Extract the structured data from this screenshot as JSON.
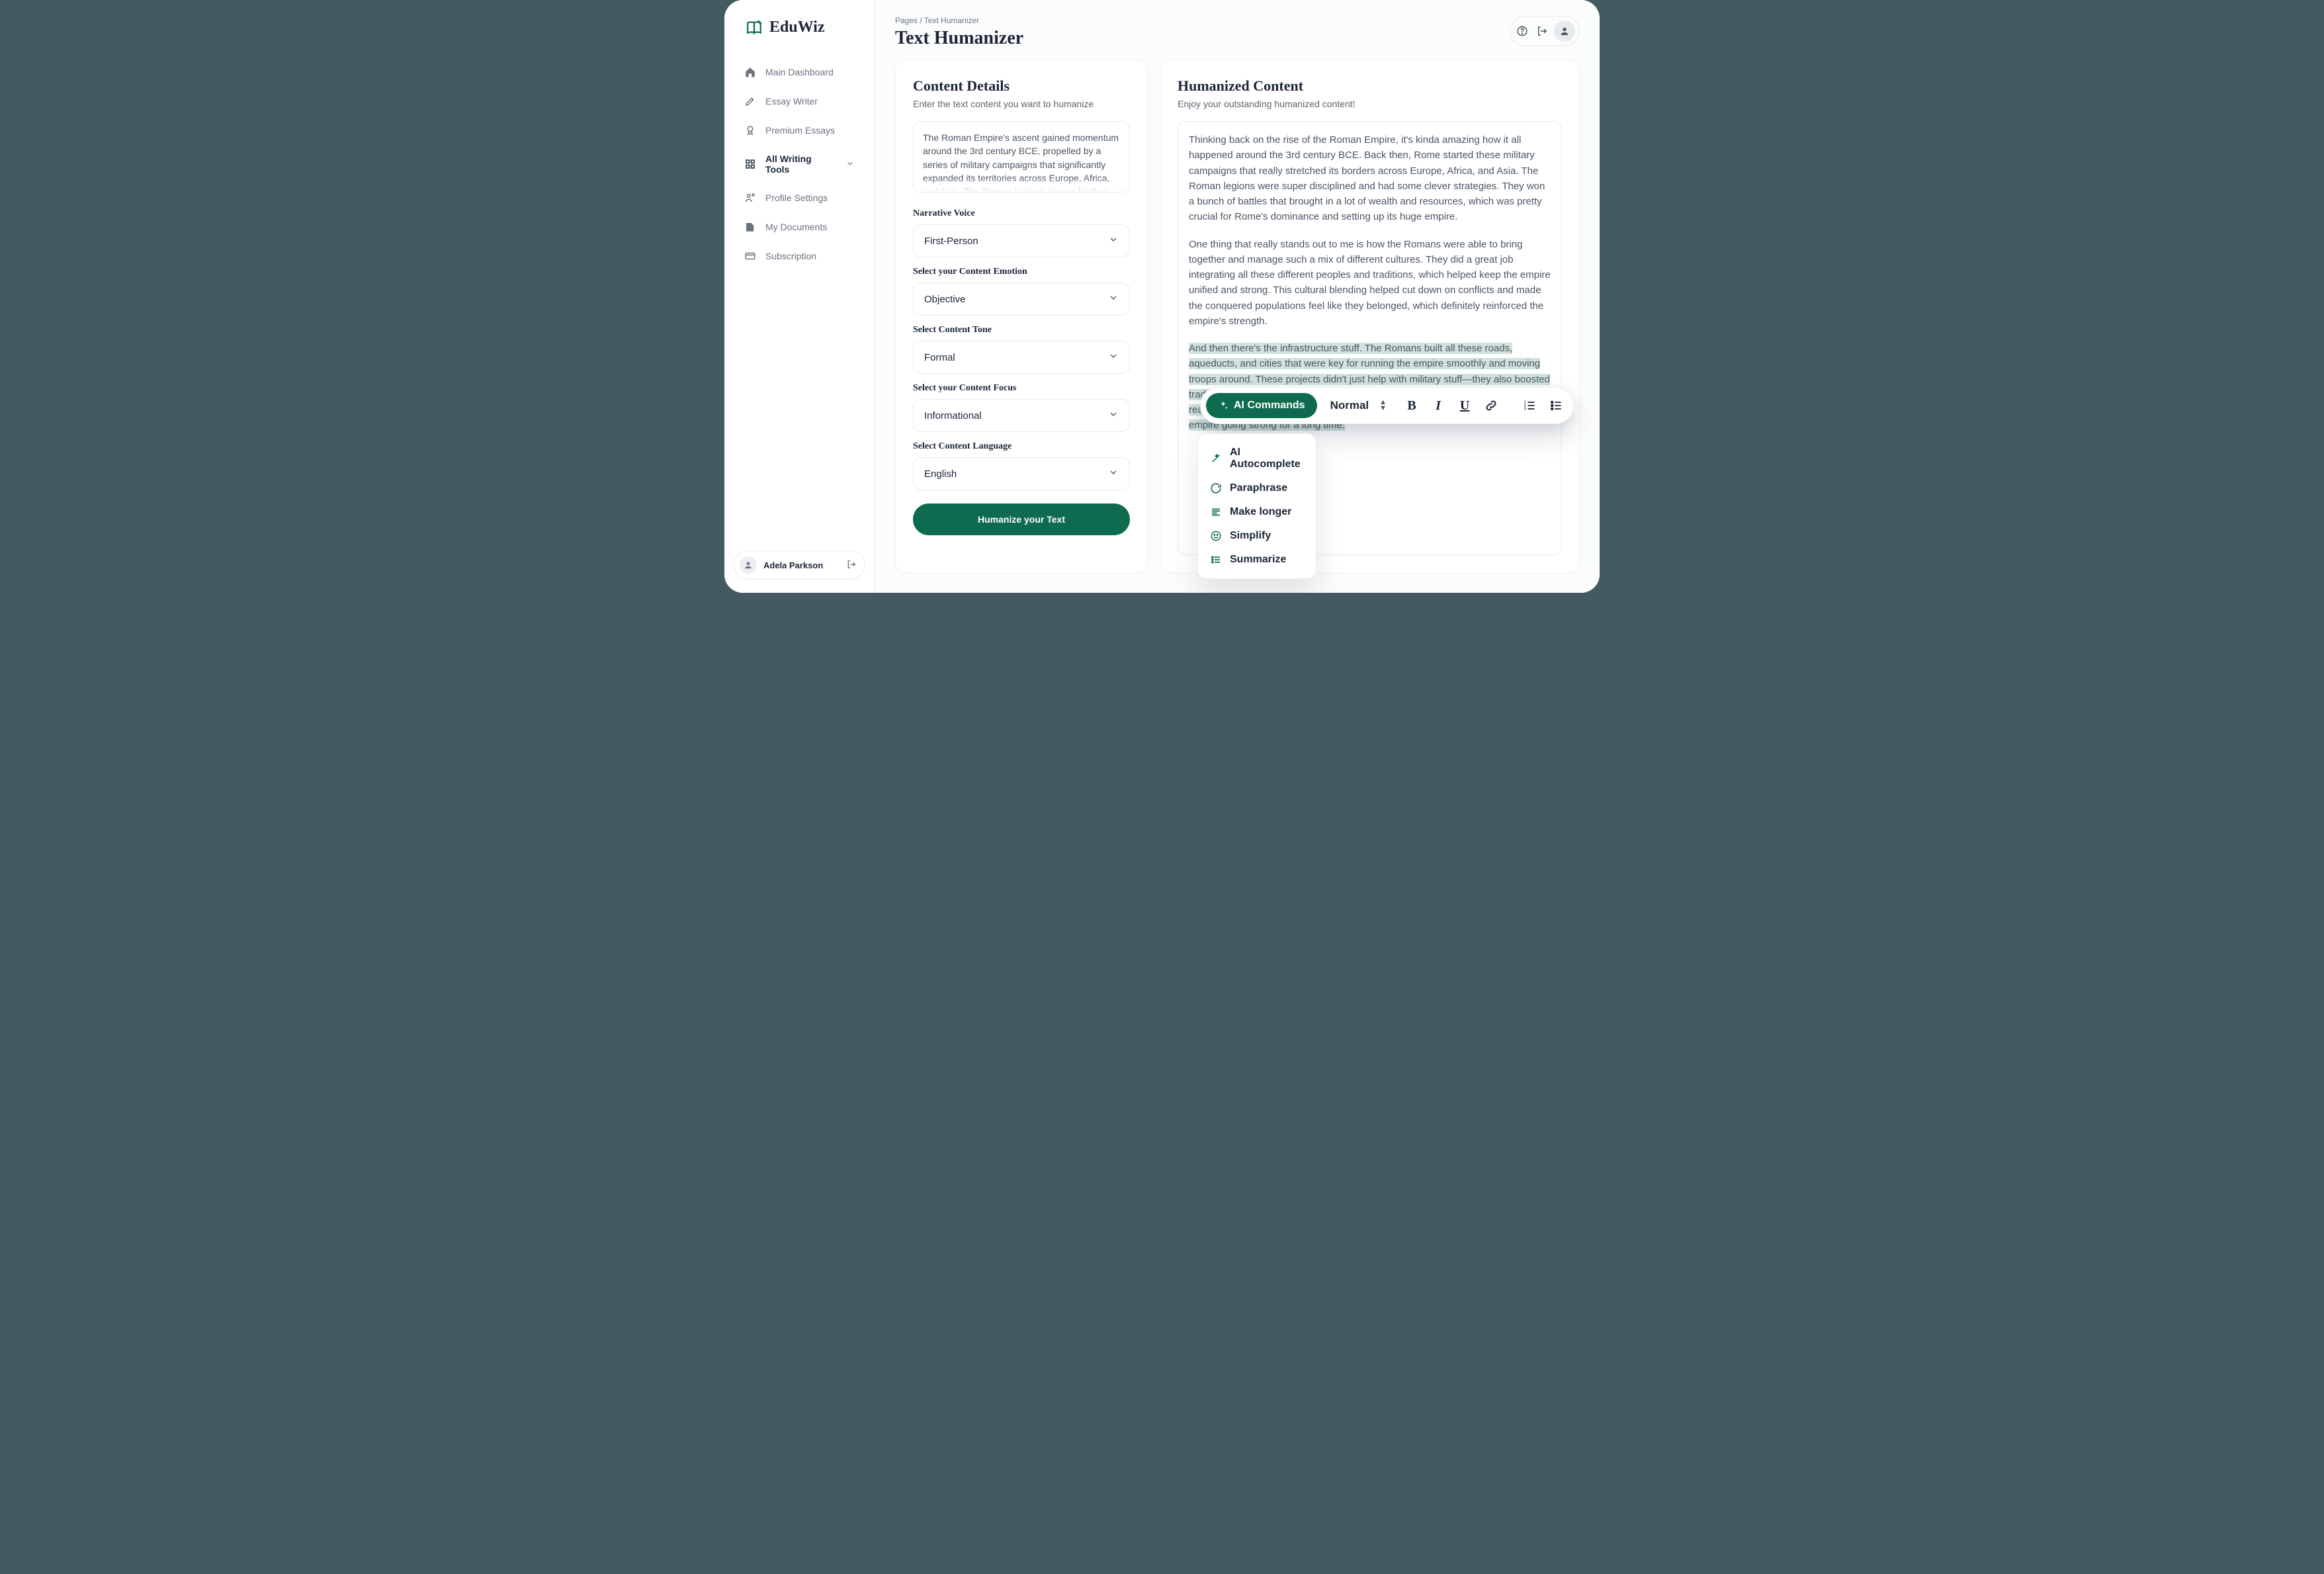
{
  "brand": {
    "name": "EduWiz"
  },
  "breadcrumbs": {
    "path": "Pages / Text Humanizer"
  },
  "page": {
    "title": "Text Humanizer"
  },
  "sidebar": {
    "items": [
      {
        "label": "Main Dashboard"
      },
      {
        "label": "Essay Writer"
      },
      {
        "label": "Premium Essays"
      },
      {
        "label": "All Writing Tools"
      },
      {
        "label": "Profile Settings"
      },
      {
        "label": "My Documents"
      },
      {
        "label": "Subscription"
      }
    ],
    "user": {
      "name": "Adela Parkson"
    }
  },
  "left_panel": {
    "title": "Content Details",
    "subtitle": "Enter the text content you want to humanize",
    "textarea": "The Roman Empire's ascent gained momentum around the 3rd century BCE, propelled by a series of military campaigns that significantly expanded its territories across Europe, Africa, and Asia. The Roman legions, known for their discipline and",
    "fields": {
      "voice": {
        "label": "Narrative Voice",
        "value": "First-Person"
      },
      "emotion": {
        "label": "Select your Content Emotion",
        "value": "Objective"
      },
      "tone": {
        "label": "Select Content Tone",
        "value": "Formal"
      },
      "focus": {
        "label": "Select your Content Focus",
        "value": "Informational"
      },
      "language": {
        "label": "Select Content Language",
        "value": "English"
      }
    },
    "cta": "Humanize your Text"
  },
  "right_panel": {
    "title": "Humanized Content",
    "subtitle": "Enjoy your outstanding humanized content!",
    "p1": "Thinking back on the rise of the Roman Empire, it's kinda amazing how it all happened around the 3rd century BCE. Back then, Rome started these military campaigns that really stretched its borders across Europe, Africa, and Asia. The Roman legions were super disciplined and had some clever strategies. They won a bunch of battles that brought in a lot of wealth and resources, which was pretty crucial for Rome's dominance and setting up its huge empire.",
    "p2": "One thing that really stands out to me is how the Romans were able to bring together and manage such a mix of different cultures. They did a great job integrating all these different peoples and traditions, which helped keep the empire unified and strong. This cultural blending helped cut down on conflicts and made the conquered populations feel like they belonged, which definitely reinforced the empire's strength.",
    "p3": "And then there's the infrastructure stuff. The Romans built all these roads, aqueducts, and cities that were key for running the empire smoothly and moving troops around. These projects didn't just help with military stuff—they also boosted trade and communication across the empire. This economic and social integration really helped solidify Roman power and created a network of regions that kept the empire going strong for a long time."
  },
  "toolbar": {
    "ai_label": "AI Commands",
    "format_label": "Normal",
    "menu": {
      "autocomplete": "AI Autocomplete",
      "paraphrase": "Paraphrase",
      "longer": "Make longer",
      "simplify": "Simplify",
      "summarize": "Summarize"
    }
  }
}
